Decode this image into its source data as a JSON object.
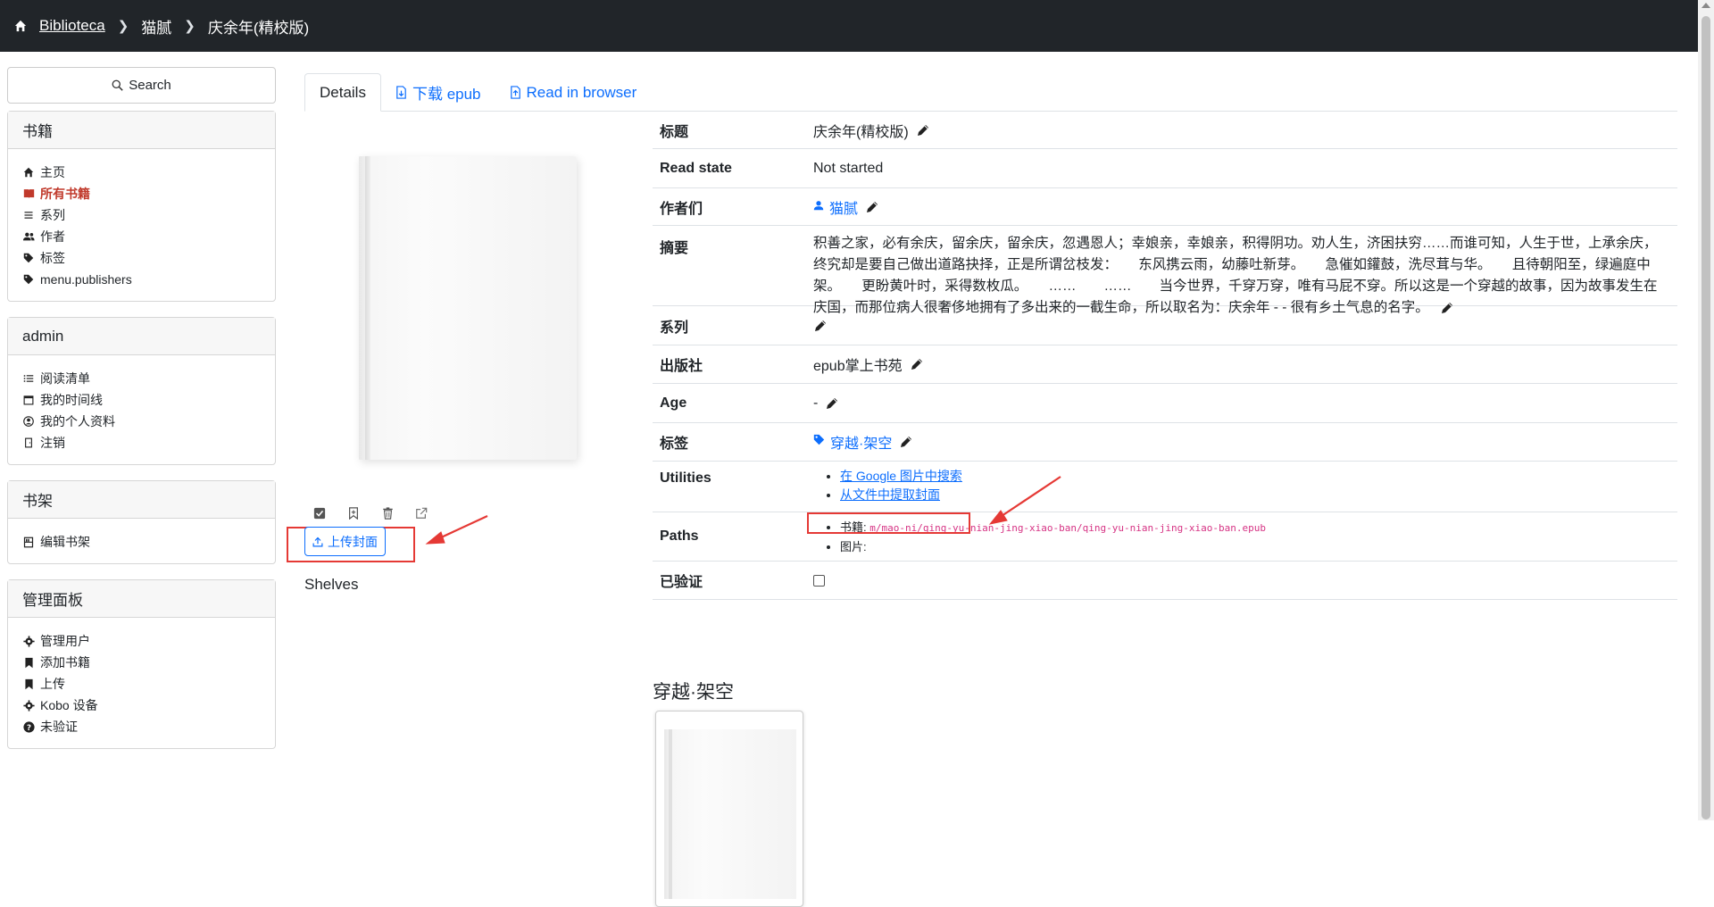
{
  "breadcrumb": {
    "home": "Biblioteca",
    "author": "猫腻",
    "title": "庆余年(精校版)"
  },
  "sidebar": {
    "search": "Search",
    "books": {
      "header": "书籍",
      "items": [
        {
          "label": "主页",
          "icon": "home-icon"
        },
        {
          "label": "所有书籍",
          "icon": "book-icon"
        },
        {
          "label": "系列",
          "icon": "list-icon"
        },
        {
          "label": "作者",
          "icon": "users-icon"
        },
        {
          "label": "标签",
          "icon": "tag-icon"
        },
        {
          "label": "menu.publishers",
          "icon": "tag-icon"
        }
      ]
    },
    "admin": {
      "header": "admin",
      "items": [
        {
          "label": "阅读清单",
          "icon": "list-icon"
        },
        {
          "label": "我的时间线",
          "icon": "calendar-icon"
        },
        {
          "label": "我的个人资料",
          "icon": "user-circle-icon"
        },
        {
          "label": "注销",
          "icon": "door-icon"
        }
      ]
    },
    "shelves": {
      "header": "书架",
      "items": [
        {
          "label": "编辑书架",
          "icon": "bookshelf-icon"
        }
      ]
    },
    "manage": {
      "header": "管理面板",
      "items": [
        {
          "label": "管理用户",
          "icon": "gear-icon"
        },
        {
          "label": "添加书籍",
          "icon": "bookmark-icon"
        },
        {
          "label": "上传",
          "icon": "bookmark-icon"
        },
        {
          "label": "Kobo 设备",
          "icon": "gear-icon"
        },
        {
          "label": "未验证",
          "icon": "question-icon"
        }
      ]
    }
  },
  "tabs": {
    "details": "Details",
    "download": "下载 epub",
    "read": "Read in browser"
  },
  "cover": {
    "upload": "上传封面",
    "shelves": "Shelves"
  },
  "details": {
    "title_k": "标题",
    "title_v": "庆余年(精校版)",
    "read_k": "Read state",
    "read_v": "Not started",
    "authors_k": "作者们",
    "authors_v": "猫腻",
    "summary_k": "摘要",
    "summary_v": "积善之家，必有余庆，留余庆，留余庆，忽遇恩人；幸娘亲，幸娘亲，积得阴功。劝人生，济困扶穷……而谁可知，人生于世，上承余庆，终究却是要自己做出道路抉择，正是所谓岔枝发：　　东风携云雨，幼藤吐新芽。　　急催如鑵鼓，洗尽茸与华。　　且待朝阳至，绿遍庭中架。　　更盼黄叶时，采得数枚瓜。　　……　　……　　当今世界，千穿万穿，唯有马屁不穿。所以这是一个穿越的故事，因为故事发生在庆国，而那位病人很奢侈地拥有了多出来的一截生命，所以取名为：庆余年 - - 很有乡土气息的名字。",
    "series_k": "系列",
    "publisher_k": "出版社",
    "publisher_v": "epub掌上书苑",
    "age_k": "Age",
    "age_v": "-",
    "tags_k": "标签",
    "tags_v": "穿越·架空",
    "utilities_k": "Utilities",
    "util_google": "在 Google 图片中搜索",
    "util_extract": "从文件中提取封面",
    "paths_k": "Paths",
    "path_book_label": "书籍:",
    "path_book_value": "m/mao-ni/qing-yu-nian-jing-xiao-ban/qing-yu-nian-jing-xiao-ban.epub",
    "path_image_label": "图片:",
    "verified_k": "已验证"
  },
  "related": {
    "title": "穿越·架空"
  }
}
